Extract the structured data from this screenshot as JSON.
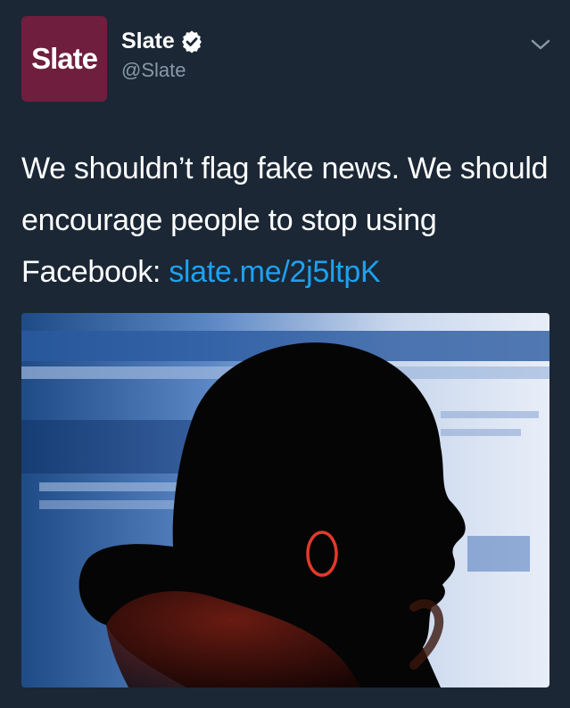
{
  "account": {
    "avatar_text": "Slate",
    "display_name": "Slate",
    "handle": "@Slate",
    "verified": true
  },
  "tweet": {
    "text": "We shouldn’t flag fake news. We should encourage people to stop using Facebook: ",
    "link_text": "slate.me/2j5ltpK"
  },
  "media": {
    "description_icon": "photo"
  },
  "icons": {
    "verified": "verified-badge-icon",
    "menu": "chevron-down-icon"
  },
  "colors": {
    "background": "#1b2735",
    "avatar_bg": "#6f1f3d",
    "link": "#1da1f2",
    "secondary_text": "#8899a6"
  }
}
